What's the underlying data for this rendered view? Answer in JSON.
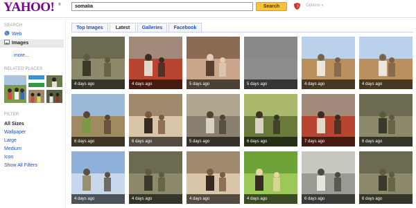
{
  "header": {
    "logo": "YAHOO!",
    "logo_mark": "®",
    "search_value": "somalia",
    "search_button": "Search",
    "options_label": "Options",
    "accent": "#7b0099",
    "button_color": "#f7c33a"
  },
  "sidebar": {
    "search_heading": "SEARCH",
    "items": [
      {
        "label": "Web",
        "icon": "globe-icon",
        "active": false
      },
      {
        "label": "Images",
        "icon": "image-icon",
        "active": true
      }
    ],
    "more": "more...",
    "related_heading": "RELATED PLACES",
    "filter_heading": "FILTER",
    "filters": [
      "All Sizes",
      "Wallpaper",
      "Large",
      "Medium",
      "Icon",
      "Show All Filters"
    ],
    "selected_filter": "All Sizes"
  },
  "tabs": [
    {
      "label": "Top Images",
      "active": false
    },
    {
      "label": "Latest",
      "active": true
    },
    {
      "label": "Galleries",
      "active": false
    },
    {
      "label": "Facebook",
      "active": false
    }
  ],
  "results": [
    {
      "age": "4 days ago",
      "scene": "soldiers"
    },
    {
      "age": "4 days ago",
      "scene": "women"
    },
    {
      "age": "5 days ago",
      "scene": "hands"
    },
    {
      "age": "5 days ago",
      "scene": "grey"
    },
    {
      "age": "4 days ago",
      "scene": "camp"
    },
    {
      "age": "4 days ago",
      "scene": "camp"
    },
    {
      "age": "6 days ago",
      "scene": "village"
    },
    {
      "age": "6 days ago",
      "scene": "people"
    },
    {
      "age": "5 days ago",
      "scene": "rubble"
    },
    {
      "age": "6 days ago",
      "scene": "shelter"
    },
    {
      "age": "7 days ago",
      "scene": "women"
    },
    {
      "age": "6 days ago",
      "scene": "soldiers"
    },
    {
      "age": "4 days ago",
      "scene": "sky"
    },
    {
      "age": "4 days ago",
      "scene": "soldiers"
    },
    {
      "age": "4 days ago",
      "scene": "people"
    },
    {
      "age": "4 days ago",
      "scene": "green"
    },
    {
      "age": "6 days ago",
      "scene": "building"
    },
    {
      "age": "6 days ago",
      "scene": "soldiers"
    }
  ]
}
